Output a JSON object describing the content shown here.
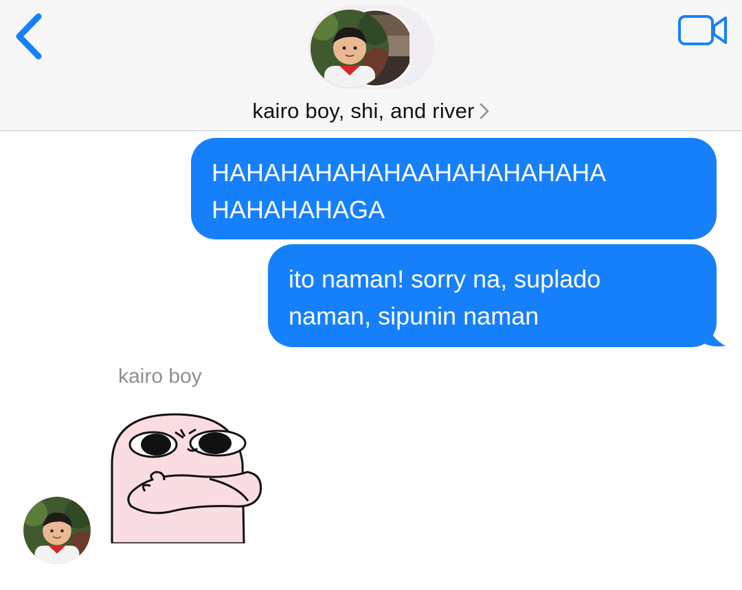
{
  "header": {
    "title": "kairo boy, shi, and river",
    "accent_color": "#1680fb",
    "back_icon": "chevron-left-icon",
    "video_icon": "video-camera-icon",
    "disclosure_icon": "chevron-right-icon"
  },
  "messages": [
    {
      "direction": "outgoing",
      "lines": [
        "HAHAHAHAHAHAAHAHAHAHAHA",
        "HAHAHAHAGA"
      ]
    },
    {
      "direction": "outgoing",
      "lines": [
        "ito naman! sorry na, suplado",
        "naman, sipunin naman"
      ]
    }
  ],
  "incoming": {
    "sender": "kairo boy",
    "content_type": "sticker",
    "sticker": "pink-character-arms-crossed-sticker"
  },
  "colors": {
    "outgoing_bubble": "#1680fb",
    "outgoing_text": "#ffffff",
    "sender_label": "#8e8e93",
    "header_background": "#f7f7f7"
  }
}
